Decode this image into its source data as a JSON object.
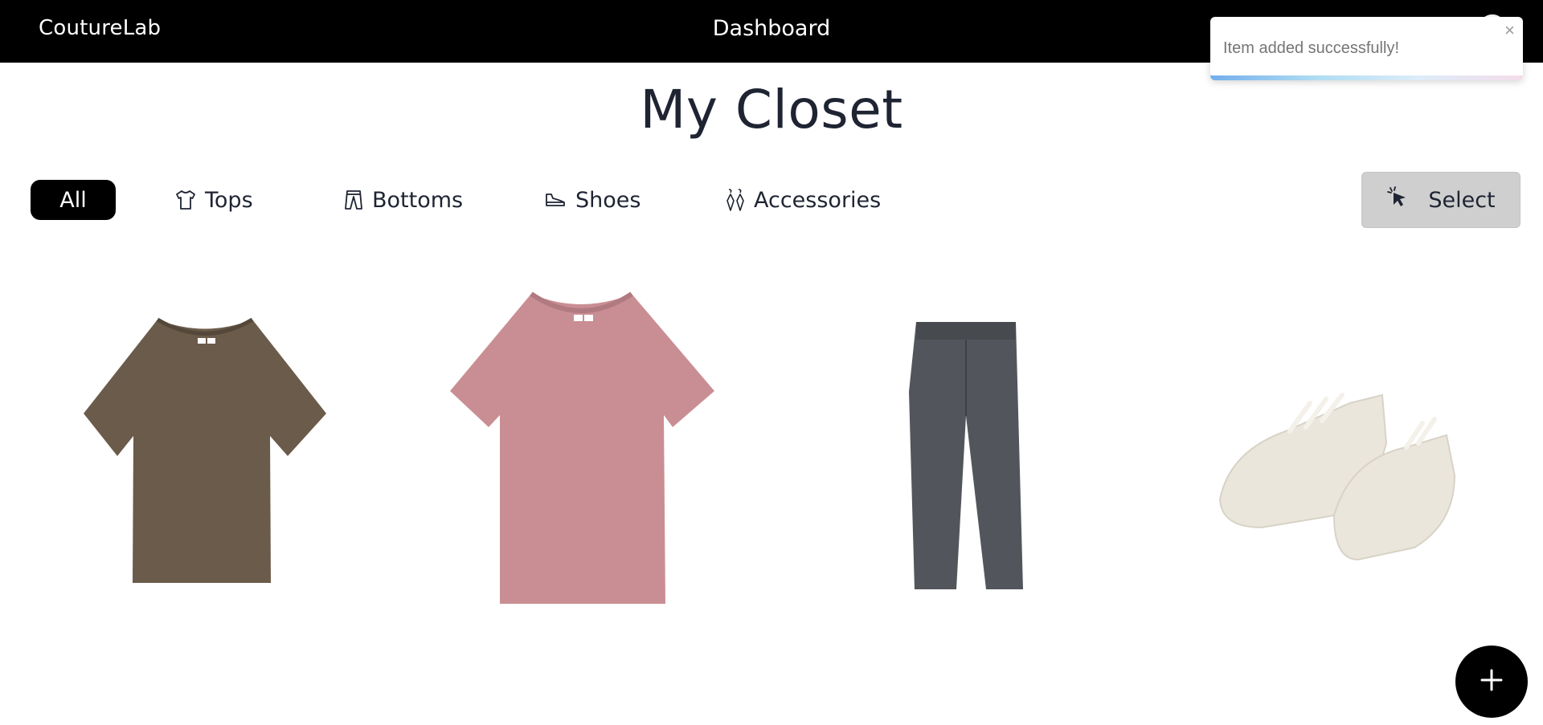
{
  "header": {
    "brand": "CoutureLab",
    "nav_title": "Dashboard"
  },
  "page": {
    "title": "My Closet"
  },
  "filters": [
    {
      "label": "All",
      "active": true
    },
    {
      "label": "Tops",
      "icon": "tshirt-icon"
    },
    {
      "label": "Bottoms",
      "icon": "pants-icon"
    },
    {
      "label": "Shoes",
      "icon": "shoe-icon"
    },
    {
      "label": "Accessories",
      "icon": "earrings-icon"
    }
  ],
  "select_button": {
    "label": "Select",
    "icon": "cursor-click-icon"
  },
  "items": [
    {
      "name": "brown-tshirt",
      "color": "#6b5b4a"
    },
    {
      "name": "pink-tshirt",
      "color": "#c98e93"
    },
    {
      "name": "gray-trousers",
      "color": "#52565c"
    },
    {
      "name": "cream-sneakers",
      "color": "#eae6dc"
    }
  ],
  "fab": {
    "icon": "plus-icon"
  },
  "toast": {
    "message": "Item added successfully!",
    "close": "×"
  }
}
